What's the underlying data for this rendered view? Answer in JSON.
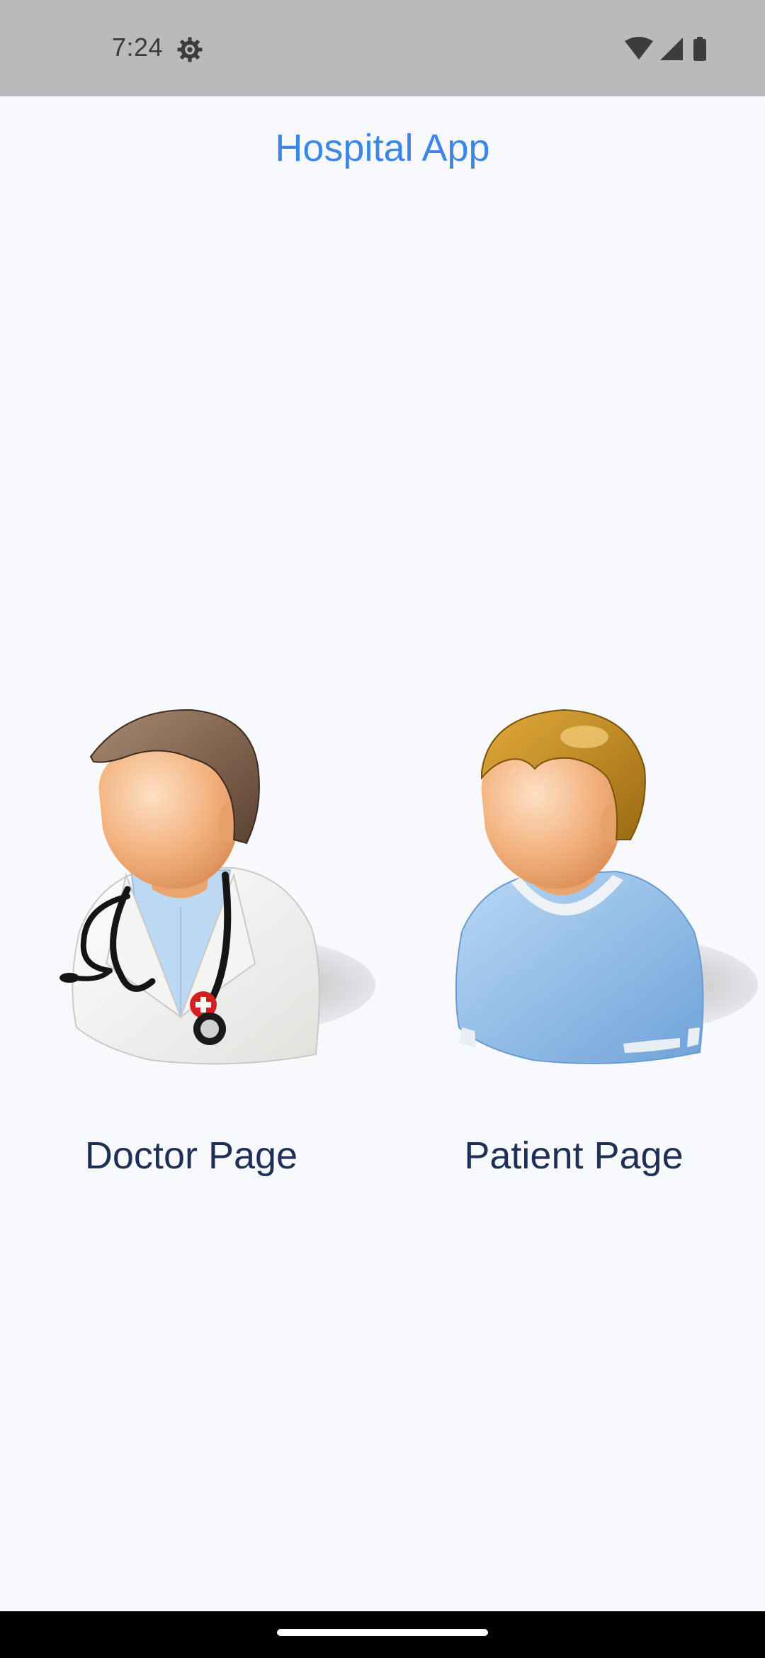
{
  "status_bar": {
    "time": "7:24",
    "icons": [
      "settings-gear-icon",
      "wifi-icon",
      "cellular-signal-icon",
      "battery-icon"
    ]
  },
  "app": {
    "title": "Hospital App"
  },
  "roles": [
    {
      "label": "Doctor Page",
      "icon": "doctor-avatar-icon"
    },
    {
      "label": "Patient Page",
      "icon": "patient-avatar-icon"
    }
  ],
  "colors": {
    "title": "#3d86e6",
    "label": "#1f2f55",
    "background": "#f8f9fd",
    "status_bar": "#b9babc"
  }
}
